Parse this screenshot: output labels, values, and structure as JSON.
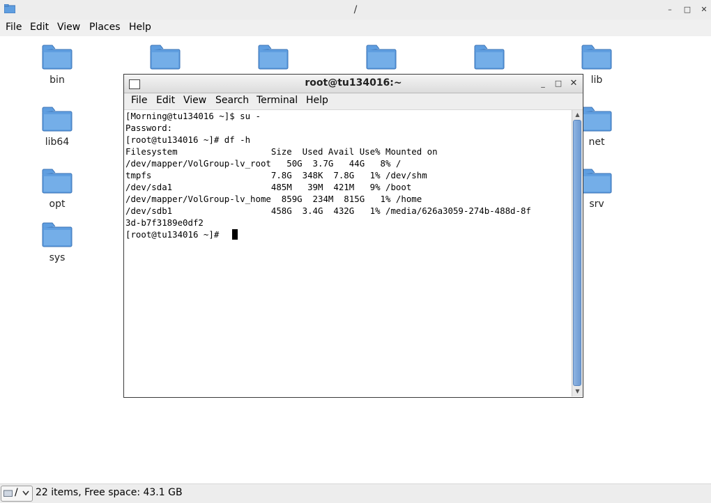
{
  "file_manager": {
    "title": "/",
    "window_controls": {
      "minimize": "–",
      "maximize": "□",
      "close": "✕"
    },
    "menu": [
      "File",
      "Edit",
      "View",
      "Places",
      "Help"
    ],
    "folders": [
      {
        "name": "bin"
      },
      {
        "name": ""
      },
      {
        "name": ""
      },
      {
        "name": ""
      },
      {
        "name": ""
      },
      {
        "name": "lib"
      },
      {
        "name": "lib64"
      },
      {
        "name": "net"
      },
      {
        "name": "opt"
      },
      {
        "name": "srv"
      },
      {
        "name": "sys"
      }
    ],
    "status": {
      "path_combo": "/",
      "text": "22 items, Free space: 43.1 GB"
    }
  },
  "terminal": {
    "title": "root@tu134016:~",
    "window_controls": {
      "minimize": "_",
      "maximize": "□",
      "close": "✕"
    },
    "menu": [
      "File",
      "Edit",
      "View",
      "Search",
      "Terminal",
      "Help"
    ],
    "lines": [
      "[Morning@tu134016 ~]$ su -",
      "Password:",
      "[root@tu134016 ~]# df -h",
      "Filesystem                  Size  Used Avail Use% Mounted on",
      "/dev/mapper/VolGroup-lv_root   50G  3.7G   44G   8% /",
      "tmpfs                       7.8G  348K  7.8G   1% /dev/shm",
      "/dev/sda1                   485M   39M  421M   9% /boot",
      "/dev/mapper/VolGroup-lv_home  859G  234M  815G   1% /home",
      "/dev/sdb1                   458G  3.4G  432G   1% /media/626a3059-274b-488d-8f",
      "3d-b7f3189e0df2",
      "[root@tu134016 ~]# "
    ]
  },
  "colors": {
    "folder": "#5f9ee0",
    "scroll_thumb": "#7aa5dc"
  }
}
